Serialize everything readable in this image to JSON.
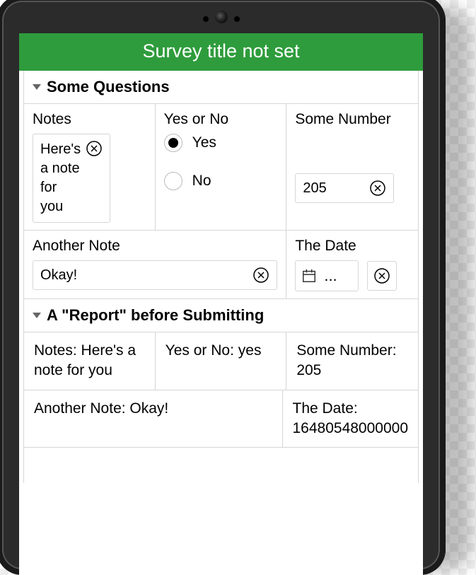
{
  "survey": {
    "title": "Survey title not set"
  },
  "section1": {
    "heading": "Some Questions",
    "notes": {
      "label": "Notes",
      "value": "Here's a note for you"
    },
    "yesno": {
      "label": "Yes or No",
      "yes": "Yes",
      "no": "No",
      "selected": "yes"
    },
    "number": {
      "label": "Some Number",
      "value": "205"
    },
    "another": {
      "label": "Another Note",
      "value": "Okay!"
    },
    "date": {
      "label": "The Date",
      "display": "..."
    }
  },
  "section2": {
    "heading": "A \"Report\" before Submitting",
    "r_notes": "Notes: Here's a note for you",
    "r_yesno": "Yes or No: yes",
    "r_number": "Some Number: 205",
    "r_another": "Another Note: Okay!",
    "r_date": "The Date: 16480548000000"
  }
}
